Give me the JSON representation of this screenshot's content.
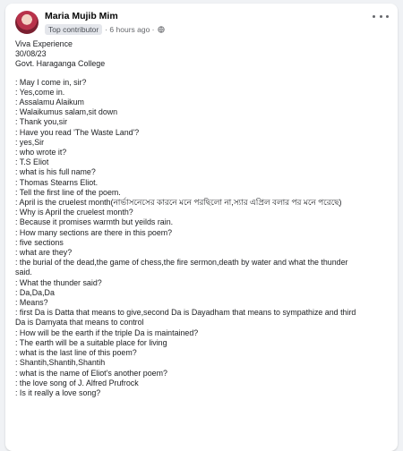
{
  "post": {
    "author": "Maria Mujib Mim",
    "badge": "Top contributor",
    "time": "· 6 hours ago ·",
    "intro": [
      "Viva Experience",
      "30/08/23",
      "Govt. Haraganga College"
    ],
    "lines": [
      ": May I come in, sir?",
      ": Yes,come in.",
      ": Assalamu Alaikum",
      ": Walaikumus salam,sit down",
      ": Thank you,sir",
      ": Have you read 'The Waste Land'?",
      ": yes,Sir",
      ": who wrote it?",
      ": T.S Eliot",
      ": what is his full name?",
      ": Thomas Stearns Eliot.",
      ": Tell the first line of the poem.",
      ": April is the cruelest month(নার্ভাসনেসের কারনে মনে পরছিলো না,স্যার এপ্রিল বলার পর মনে পরেছে)",
      ": Why is April the cruelest month?",
      ": Because it promises warmth but yeilds rain.",
      ": How many sections are there in this poem?",
      ": five sections",
      ": what are they?",
      ": the burial of the dead,the game of chess,the fire sermon,death by water and what the thunder",
      "said.",
      ": What the thunder said?",
      ": Da,Da,Da",
      ": Means?",
      ": first Da is Datta that means to give,second Da is Dayadham that means to sympathize and third",
      "Da is Damyata that means to control",
      ": How will be the earth if the triple Da is maintained?",
      ": The earth will be a suitable place for living",
      ": what is the last line of this poem?",
      ": Shantih,Shantih,Shantih",
      ": what is the name of Eliot's another poem?",
      ": the love song of J. Alfred Prufrock",
      ": Is it really a love song?"
    ]
  },
  "icons": {
    "privacy": "globe-icon",
    "options": "more-options-icon"
  },
  "colors": {
    "card": "#ffffff",
    "page": "#f0f2f5",
    "text": "#1c1e21",
    "meta": "#65676b"
  }
}
